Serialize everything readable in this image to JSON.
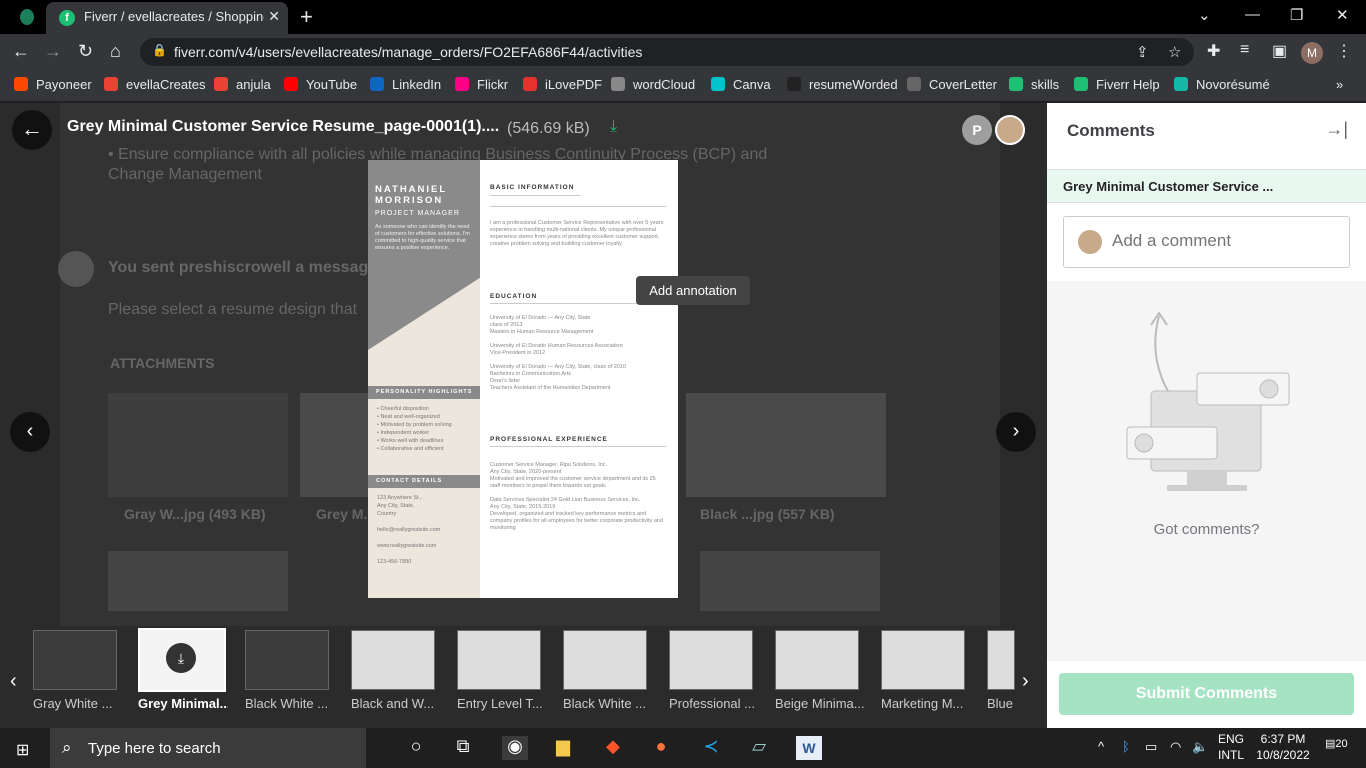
{
  "browser": {
    "tab_title": "Fiverr / evellacreates / Shopping",
    "url": "fiverr.com/v4/users/evellacreates/manage_orders/FO2EFA686F44/activities",
    "avatar_letter": "M"
  },
  "bookmarks": [
    {
      "label": "Payoneer",
      "color": "#ff4800"
    },
    {
      "label": "evellaCreates",
      "color": "#ea4335"
    },
    {
      "label": "anjula",
      "color": "#ea4335"
    },
    {
      "label": "YouTube",
      "color": "#ff0000"
    },
    {
      "label": "LinkedIn",
      "color": "#0a66c2"
    },
    {
      "label": "Flickr",
      "color": "#ff0084"
    },
    {
      "label": "iLovePDF",
      "color": "#e5322d"
    },
    {
      "label": "wordCloud",
      "color": "#888888"
    },
    {
      "label": "Canva",
      "color": "#00c4cc"
    },
    {
      "label": "resumeWorded",
      "color": "#222222"
    },
    {
      "label": "CoverLetter",
      "color": "#666666"
    },
    {
      "label": "skills",
      "color": "#1dbf73"
    },
    {
      "label": "Fiverr Help",
      "color": "#1dbf73"
    },
    {
      "label": "Novorésumé",
      "color": "#14b8a6"
    }
  ],
  "viewer": {
    "file_title": "Grey Minimal Customer Service Resume_page-0001(1)....",
    "file_size": "(546.69 kB)",
    "participant_letter": "P",
    "tooltip": "Add annotation",
    "background_lines": [
      "• Ensure compliance with all policies while managing Business Continuity Process (BCP) and",
      "Change Management",
      "You sent preshiscrowell a message",
      "Please select a resume design that",
      "ATTACHMENTS",
      "Gray W...jpg (493 KB)",
      "Grey M...",
      "Black ...jpg (557 KB)"
    ]
  },
  "resume": {
    "name": "NATHANIEL MORRISON",
    "role": "PROJECT MANAGER",
    "intro": "As someone who can identify the need of customers for effective solutions, I'm committed to high-quality service that ensures a positive experience.",
    "highlights_title": "PERSONALITY HIGHLIGHTS",
    "highlights": "• Cheerful disposition\n• Neat and well-organized\n• Motivated by problem solving\n• Independent worker\n• Works well with deadlines\n• Collaborative and efficient",
    "contact_title": "CONTACT DETAILS",
    "contact": "123 Anywhere St.,\nAny City, State,\nCountry\n\nhello@reallygreatsite.com\n\nwww.reallygreatsite.com\n\n123-456-7890",
    "basic_title": "BASIC INFORMATION",
    "basic": "I am a professional Customer Service Representative with over 5 years experience in handling multi-national clients. My unique professional experience stems from years of providing excellent customer support, creative problem solving and building customer loyalty.",
    "education_title": "EDUCATION",
    "education": "University of El Dorado — Any City, State\nclass of 2013\nMasters in Human Resource Management\n\nUniversity of El Dorado Human Resources Association\nVice-President in 2012\n\nUniversity of El Dorado — Any City, State, class of 2010\nBachelors in Communication Arts\nDean's lister\nTeachers Assistant of the Humanities Department",
    "experience_title": "PROFESSIONAL EXPERIENCE",
    "experience": "Customer Service Manager, Ripu Solutions, Inc.\nAny City, State, 2020-present\nMotivated and improved the customer service department and its 25 staff members to propel them towards set goals\n\nData Services Specialist 24 Gold Lion Business Services, Inc.\nAny City, State, 2015-2019\nDeveloped, organized and tracked key performance metrics and company profiles for all employees for better corporate productivity and monitoring"
  },
  "thumbnails": [
    {
      "label": "Gray White ...",
      "selected": false
    },
    {
      "label": "Grey Minimal...",
      "selected": true
    },
    {
      "label": "Black White ...",
      "selected": false
    },
    {
      "label": "Black and W...",
      "selected": false
    },
    {
      "label": "Entry Level T...",
      "selected": false
    },
    {
      "label": "Black White ...",
      "selected": false
    },
    {
      "label": "Professional ...",
      "selected": false
    },
    {
      "label": "Beige Minima...",
      "selected": false
    },
    {
      "label": "Marketing M...",
      "selected": false
    },
    {
      "label": "Blue",
      "selected": false
    }
  ],
  "comments": {
    "title": "Comments",
    "file_chip": "Grey Minimal Customer Service ...",
    "input_placeholder": "Add a comment",
    "empty_text": "Got comments?",
    "submit_label": "Submit Comments"
  },
  "taskbar": {
    "search_placeholder": "Type here to search",
    "lang_line1": "ENG",
    "lang_line2": "INTL",
    "time": "6:37 PM",
    "date": "10/8/2022",
    "notif_count": "20"
  }
}
